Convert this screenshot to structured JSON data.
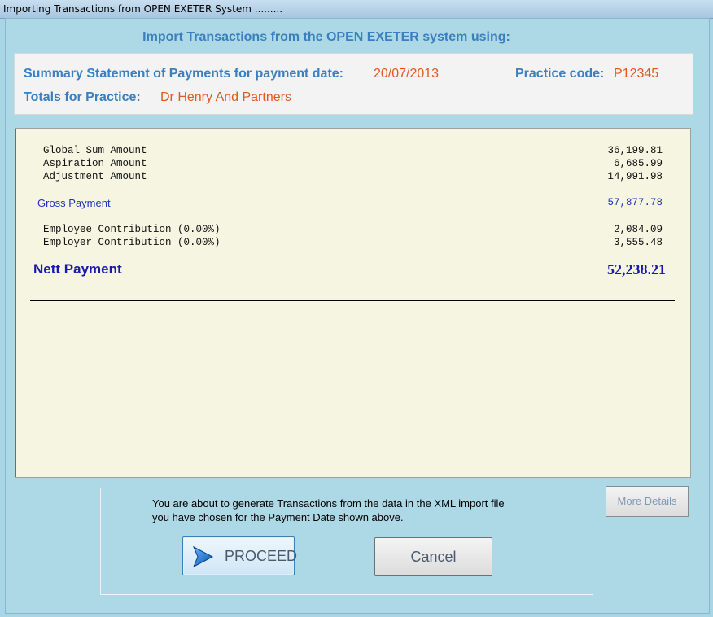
{
  "window": {
    "title": "Importing Transactions from OPEN EXETER System ........."
  },
  "header": {
    "heading": "Import Transactions from the OPEN EXETER system using:"
  },
  "summary": {
    "statement_label": "Summary Statement of Payments for payment date:",
    "payment_date": "20/07/2013",
    "practice_code_label": "Practice code:",
    "practice_code": "P12345",
    "totals_label": "Totals for Practice:",
    "practice_name": "Dr Henry And Partners"
  },
  "statement": {
    "lines": [
      {
        "name": "Global Sum Amount",
        "amount": "36,199.81"
      },
      {
        "name": "Aspiration Amount",
        "amount": "6,685.99"
      },
      {
        "name": "Adjustment Amount",
        "amount": "14,991.98"
      }
    ],
    "gross": {
      "name": "Gross Payment",
      "amount": "57,877.78"
    },
    "contributions": [
      {
        "name": "Employee Contribution (0.00%)",
        "amount": "2,084.09"
      },
      {
        "name": "Employer Contribution (0.00%)",
        "amount": "3,555.48"
      }
    ],
    "nett": {
      "name": "Nett Payment",
      "amount": "52,238.21"
    }
  },
  "footer": {
    "message_line1": "You are about to generate Transactions from the data in the XML import file",
    "message_line2": "you have chosen for the Payment Date shown above.",
    "proceed_label": "PROCEED",
    "cancel_label": "Cancel",
    "more_details_label": "More Details"
  },
  "colors": {
    "accent_blue": "#3a7fbf",
    "value_orange": "#e05a1e",
    "nett_blue": "#1a1aa8"
  }
}
